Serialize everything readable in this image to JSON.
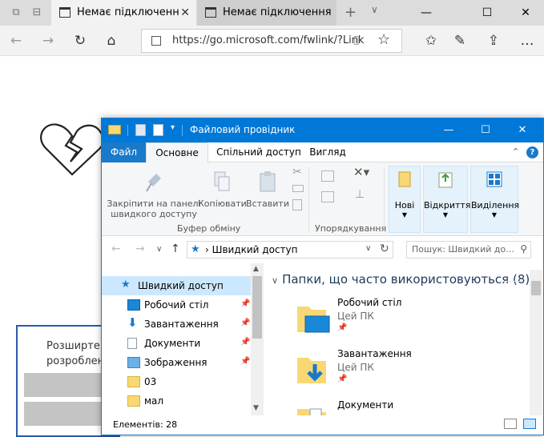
{
  "browser": {
    "tabs": [
      {
        "title": "Немає підключенн",
        "active": true
      },
      {
        "title": "Немає підключення",
        "active": false
      }
    ],
    "url": "https://go.microsoft.com/fwlink/?Link"
  },
  "promo": {
    "line1": "Розширте с",
    "line2": "розроблен"
  },
  "explorer": {
    "title": "Файловий провідник",
    "tabs": [
      "Файл",
      "Основне",
      "Спільний доступ",
      "Вигляд"
    ],
    "ribbon": {
      "clipboard": {
        "pin_line1": "Закріпити на панелі",
        "pin_line2": "швидкого доступу",
        "copy": "Копіювати",
        "paste": "Вставити",
        "group": "Буфер обміну"
      },
      "organize": {
        "group": "Упорядкування"
      },
      "new": "Нові",
      "open": "Відкриття",
      "select": "Виділення"
    },
    "address": {
      "path": "Швидкий доступ",
      "search_placeholder": "Пошук: Швидкий до..."
    },
    "nav_items": [
      {
        "label": "Швидкий доступ",
        "icon": "star-pin-icon"
      },
      {
        "label": "Робочий стіл",
        "icon": "desktop-icon",
        "pinned": true
      },
      {
        "label": "Завантаження",
        "icon": "download-icon",
        "pinned": true
      },
      {
        "label": "Документи",
        "icon": "documents-icon",
        "pinned": true
      },
      {
        "label": "Зображення",
        "icon": "pictures-icon",
        "pinned": true
      },
      {
        "label": "03",
        "icon": "folder-icon"
      },
      {
        "label": "мал",
        "icon": "folder-icon"
      }
    ],
    "frequent": {
      "header": "Папки, що часто використовуються (8)",
      "items": [
        {
          "name": "Робочий стіл",
          "location": "Цей ПК"
        },
        {
          "name": "Завантаження",
          "location": "Цей ПК"
        },
        {
          "name": "Документи",
          "location": ""
        }
      ]
    },
    "status": "Елементів: 28"
  },
  "colors": {
    "accent": "#0078d7",
    "selection": "#cce8ff",
    "folder": "#f8d775"
  }
}
